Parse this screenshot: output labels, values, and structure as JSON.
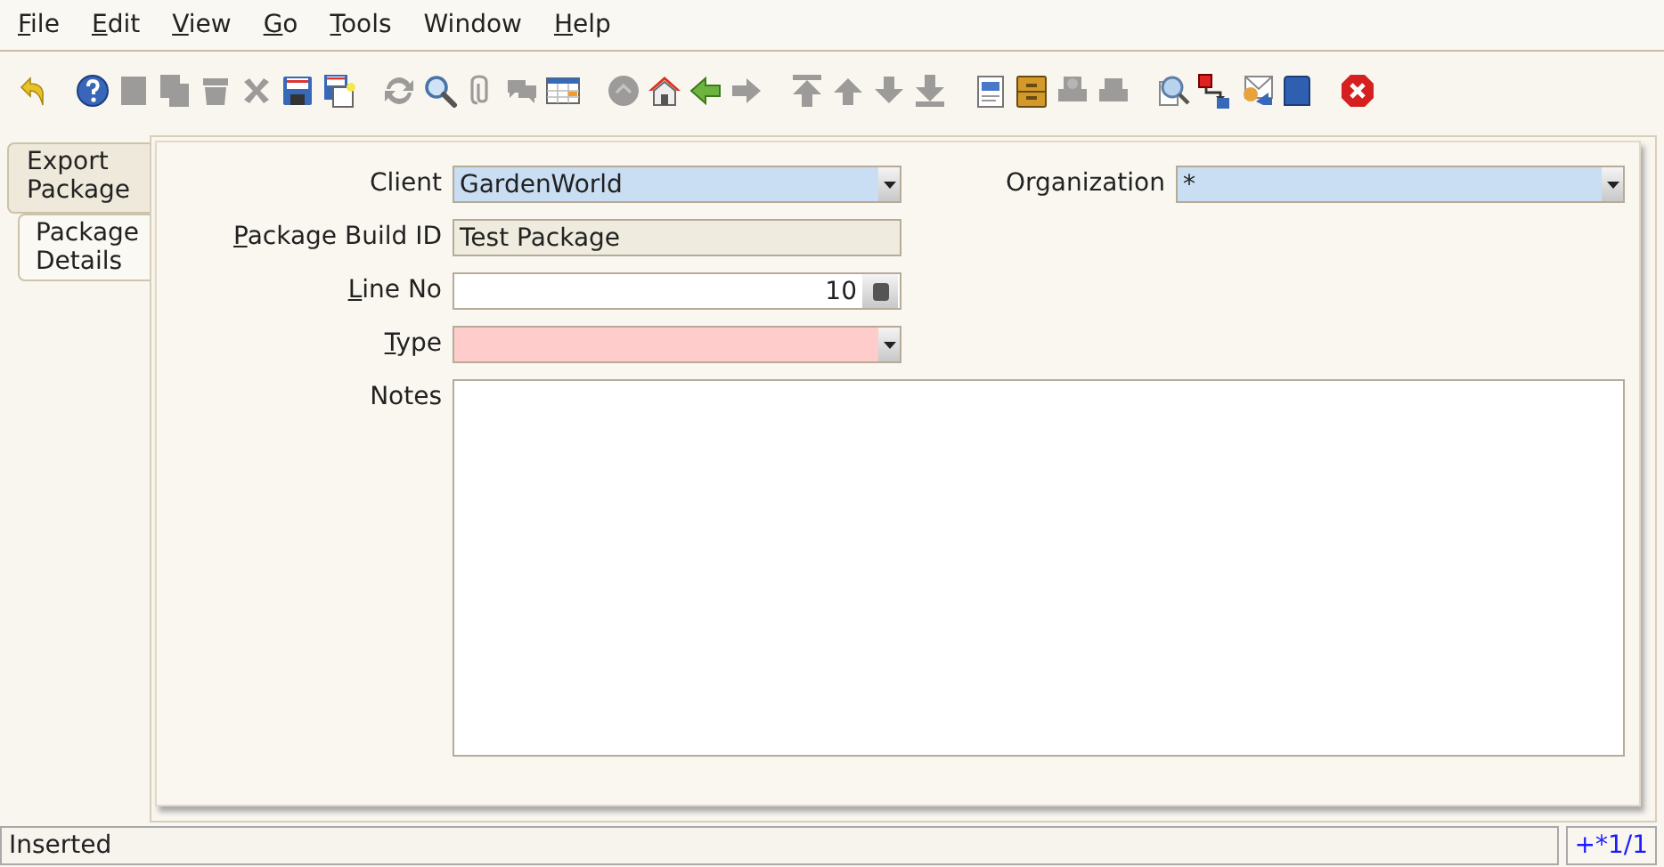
{
  "menu": [
    {
      "label": "File",
      "mnemonic": true
    },
    {
      "label": "Edit",
      "mnemonic": true
    },
    {
      "label": "View",
      "mnemonic": true
    },
    {
      "label": "Go",
      "mnemonic": true
    },
    {
      "label": "Tools",
      "mnemonic": true
    },
    {
      "label": "Window",
      "mnemonic": false
    },
    {
      "label": "Help",
      "mnemonic": true
    }
  ],
  "toolbar": [
    [
      {
        "kind": "undo",
        "disabled": false
      }
    ],
    [
      {
        "kind": "help",
        "disabled": false
      },
      {
        "kind": "new",
        "disabled": true
      },
      {
        "kind": "copy",
        "disabled": true
      },
      {
        "kind": "delete",
        "disabled": true
      },
      {
        "kind": "delete_selection",
        "disabled": true
      },
      {
        "kind": "save",
        "disabled": false
      },
      {
        "kind": "save_new",
        "disabled": false
      }
    ],
    [
      {
        "kind": "refresh",
        "disabled": true
      },
      {
        "kind": "find",
        "disabled": false
      },
      {
        "kind": "attachment",
        "disabled": true
      },
      {
        "kind": "chat",
        "disabled": true
      },
      {
        "kind": "grid",
        "disabled": false
      }
    ],
    [
      {
        "kind": "history",
        "disabled": true
      },
      {
        "kind": "home",
        "disabled": false
      },
      {
        "kind": "back",
        "disabled": false
      },
      {
        "kind": "forward",
        "disabled": true
      }
    ],
    [
      {
        "kind": "first",
        "disabled": true
      },
      {
        "kind": "previous",
        "disabled": true
      },
      {
        "kind": "next",
        "disabled": true
      },
      {
        "kind": "last",
        "disabled": true
      }
    ],
    [
      {
        "kind": "report",
        "disabled": false
      },
      {
        "kind": "archive",
        "disabled": false
      },
      {
        "kind": "print_preview",
        "disabled": true
      },
      {
        "kind": "print",
        "disabled": true
      }
    ],
    [
      {
        "kind": "zoom",
        "disabled": false
      },
      {
        "kind": "workflow",
        "disabled": false
      },
      {
        "kind": "request",
        "disabled": false
      },
      {
        "kind": "product",
        "disabled": false
      }
    ],
    [
      {
        "kind": "exit",
        "disabled": false
      }
    ]
  ],
  "tabs": [
    {
      "label": "Export Package",
      "selected": false
    },
    {
      "label": "Package Details",
      "selected": true
    }
  ],
  "form": {
    "client": {
      "label": "Client",
      "mnemonic": false,
      "value": "GardenWorld"
    },
    "organization": {
      "label": "Organization",
      "mnemonic": false,
      "value": "*"
    },
    "package_build_id": {
      "label": "Package Build ID",
      "mnemonic": true,
      "value": "Test Package"
    },
    "line_no": {
      "label": "Line No",
      "mnemonic": true,
      "value": "10"
    },
    "type": {
      "label": "Type",
      "mnemonic": true,
      "mandatory": true
    },
    "notes": {
      "label": "Notes",
      "mnemonic": false
    }
  },
  "status_bar": {
    "message": "Inserted",
    "record": "+*1/1"
  }
}
